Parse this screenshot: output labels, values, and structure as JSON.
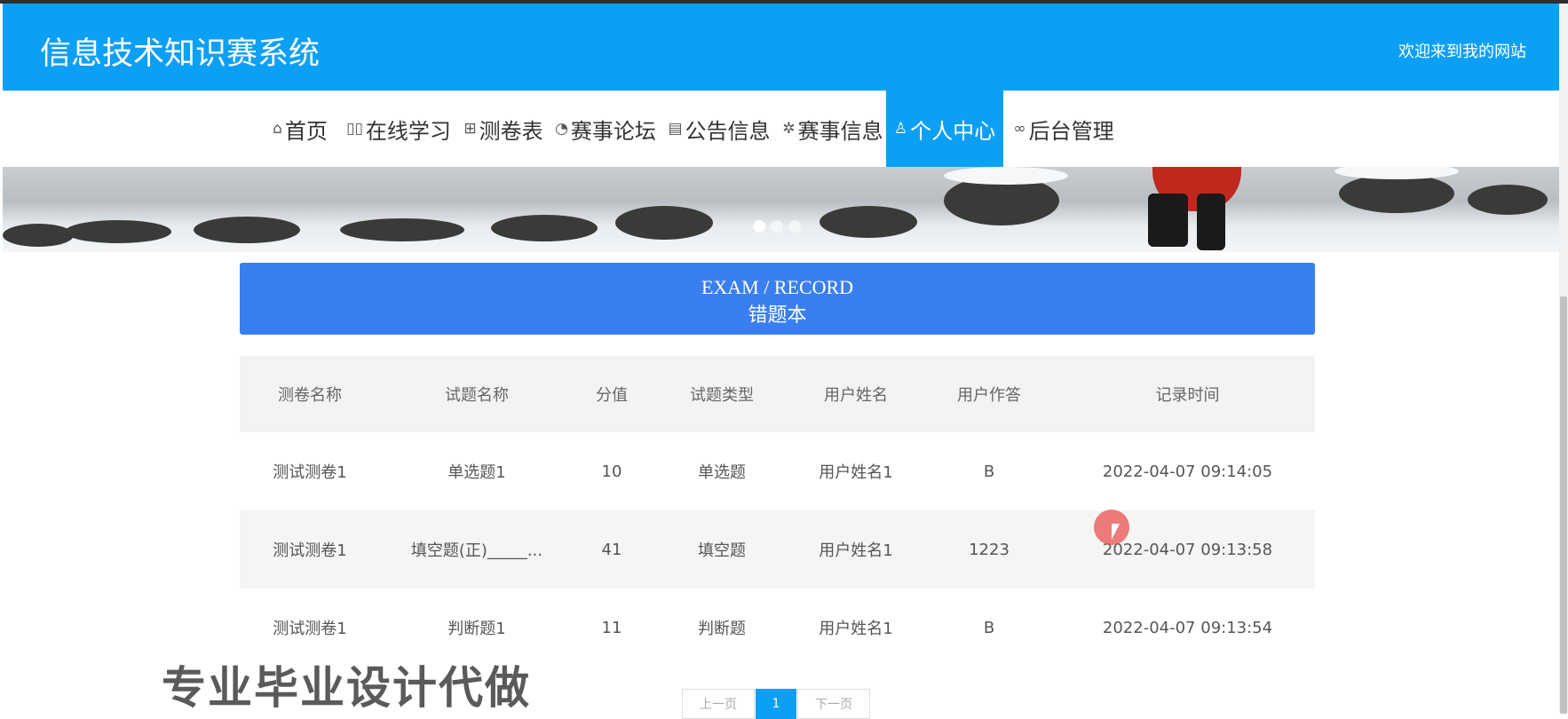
{
  "header": {
    "title": "信息技术知识赛系统",
    "welcome": "欢迎来到我的网站",
    "accent_color": "#0ca0f5"
  },
  "nav": {
    "items": [
      {
        "icon": "home-icon",
        "label": "首页"
      },
      {
        "icon": "book-icon",
        "label": "在线学习"
      },
      {
        "icon": "gift-icon",
        "label": "测卷表"
      },
      {
        "icon": "palette-icon",
        "label": "赛事论坛"
      },
      {
        "icon": "clipboard-icon",
        "label": "公告信息"
      },
      {
        "icon": "spinner-icon",
        "label": "赛事信息"
      },
      {
        "icon": "user-icon",
        "label": "个人中心",
        "active": true
      },
      {
        "icon": "link-icon",
        "label": "后台管理"
      }
    ]
  },
  "carousel": {
    "slides": 3,
    "active": 1
  },
  "section": {
    "title_en": "EXAM / RECORD",
    "title_cn": "错题本",
    "color": "#3a7ff0"
  },
  "table": {
    "columns": [
      "测卷名称",
      "试题名称",
      "分值",
      "试题类型",
      "用户姓名",
      "用户作答",
      "记录时间"
    ],
    "rows": [
      [
        "测试测卷1",
        "单选题1",
        "10",
        "单选题",
        "用户姓名1",
        "B",
        "2022-04-07 09:14:05"
      ],
      [
        "测试测卷1",
        "填空题(正)_____...",
        "41",
        "填空题",
        "用户姓名1",
        "1223",
        "2022-04-07 09:13:58"
      ],
      [
        "测试测卷1",
        "判断题1",
        "11",
        "判断题",
        "用户姓名1",
        "B",
        "2022-04-07 09:13:54"
      ]
    ]
  },
  "pagination": {
    "prev": "上一页",
    "current": "1",
    "next": "下一页"
  },
  "watermark": "专业毕业设计代做"
}
